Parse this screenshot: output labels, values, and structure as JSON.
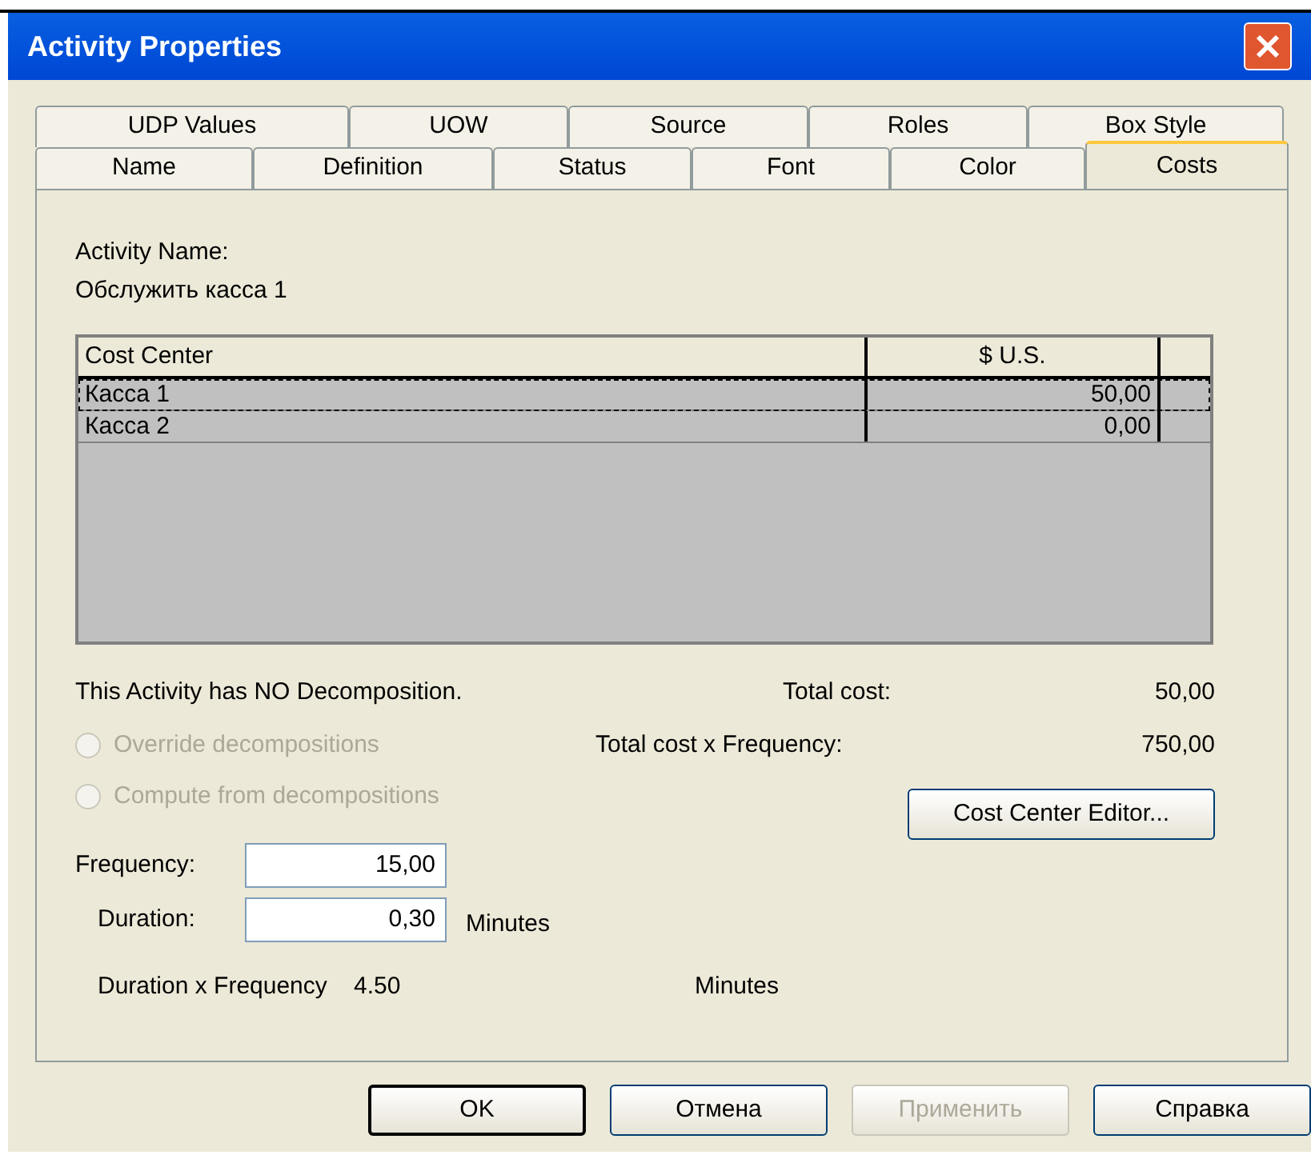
{
  "window": {
    "title": "Activity Properties"
  },
  "tab_rows": [
    {
      "tabs": [
        {
          "label": "UDP Values",
          "selected": false
        },
        {
          "label": "UOW",
          "selected": false
        },
        {
          "label": "Source",
          "selected": false
        },
        {
          "label": "Roles",
          "selected": false
        },
        {
          "label": "Box Style",
          "selected": false
        }
      ]
    },
    {
      "tabs": [
        {
          "label": "Name",
          "selected": false
        },
        {
          "label": "Definition",
          "selected": false
        },
        {
          "label": "Status",
          "selected": false
        },
        {
          "label": "Font",
          "selected": false
        },
        {
          "label": "Color",
          "selected": false
        },
        {
          "label": "Costs",
          "selected": true
        }
      ]
    }
  ],
  "activity_name_label": "Activity Name:",
  "activity_name": "Обслужить касса 1",
  "table": {
    "columns": [
      "Cost Center",
      "$ U.S."
    ],
    "rows": [
      {
        "cells": [
          "Касса 1",
          "50,00"
        ],
        "selected": true
      },
      {
        "cells": [
          "Касса 2",
          "0,00"
        ],
        "selected": false
      }
    ]
  },
  "decomposition_note": "This Activity has NO Decomposition.",
  "options": [
    {
      "label": "Override decompositions",
      "selected": false,
      "disabled": true
    },
    {
      "label": "Compute from decompositions",
      "selected": false,
      "disabled": true
    }
  ],
  "totals": [
    {
      "label": "Total cost:",
      "value": "50,00"
    },
    {
      "label": "Total cost x Frequency:",
      "value": "750,00"
    }
  ],
  "cost_center_editor_button": "Cost Center Editor...",
  "frequency": {
    "label": "Frequency:",
    "value": "15,00"
  },
  "duration": {
    "label": "Duration:",
    "value": "0,30",
    "unit": "Minutes"
  },
  "duration_x_frequency": {
    "label": "Duration x Frequency",
    "value": "4.50",
    "unit": "Minutes"
  },
  "buttons": [
    {
      "label": "OK",
      "disabled": false,
      "default": true
    },
    {
      "label": "Отмена",
      "disabled": false,
      "default": false
    },
    {
      "label": "Применить",
      "disabled": true,
      "default": false
    },
    {
      "label": "Справка",
      "disabled": false,
      "default": false
    }
  ]
}
